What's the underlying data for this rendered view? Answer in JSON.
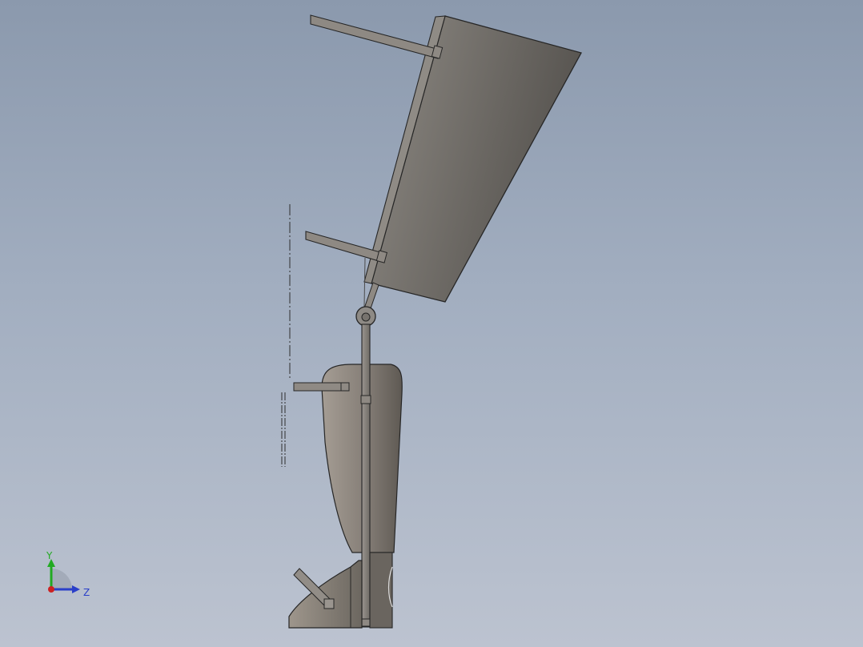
{
  "viewport": {
    "background_top": "#8b99ad",
    "background_bottom": "#bcc3d0"
  },
  "model": {
    "part_color_light": "#a59d94",
    "part_color_dark": "#5e5953",
    "edge_color": "#262626"
  },
  "triad": {
    "y_label": "Y",
    "z_label": "Z",
    "y_color": "#22aa22",
    "z_color": "#2a3fc9",
    "x_color": "#cc2222"
  }
}
